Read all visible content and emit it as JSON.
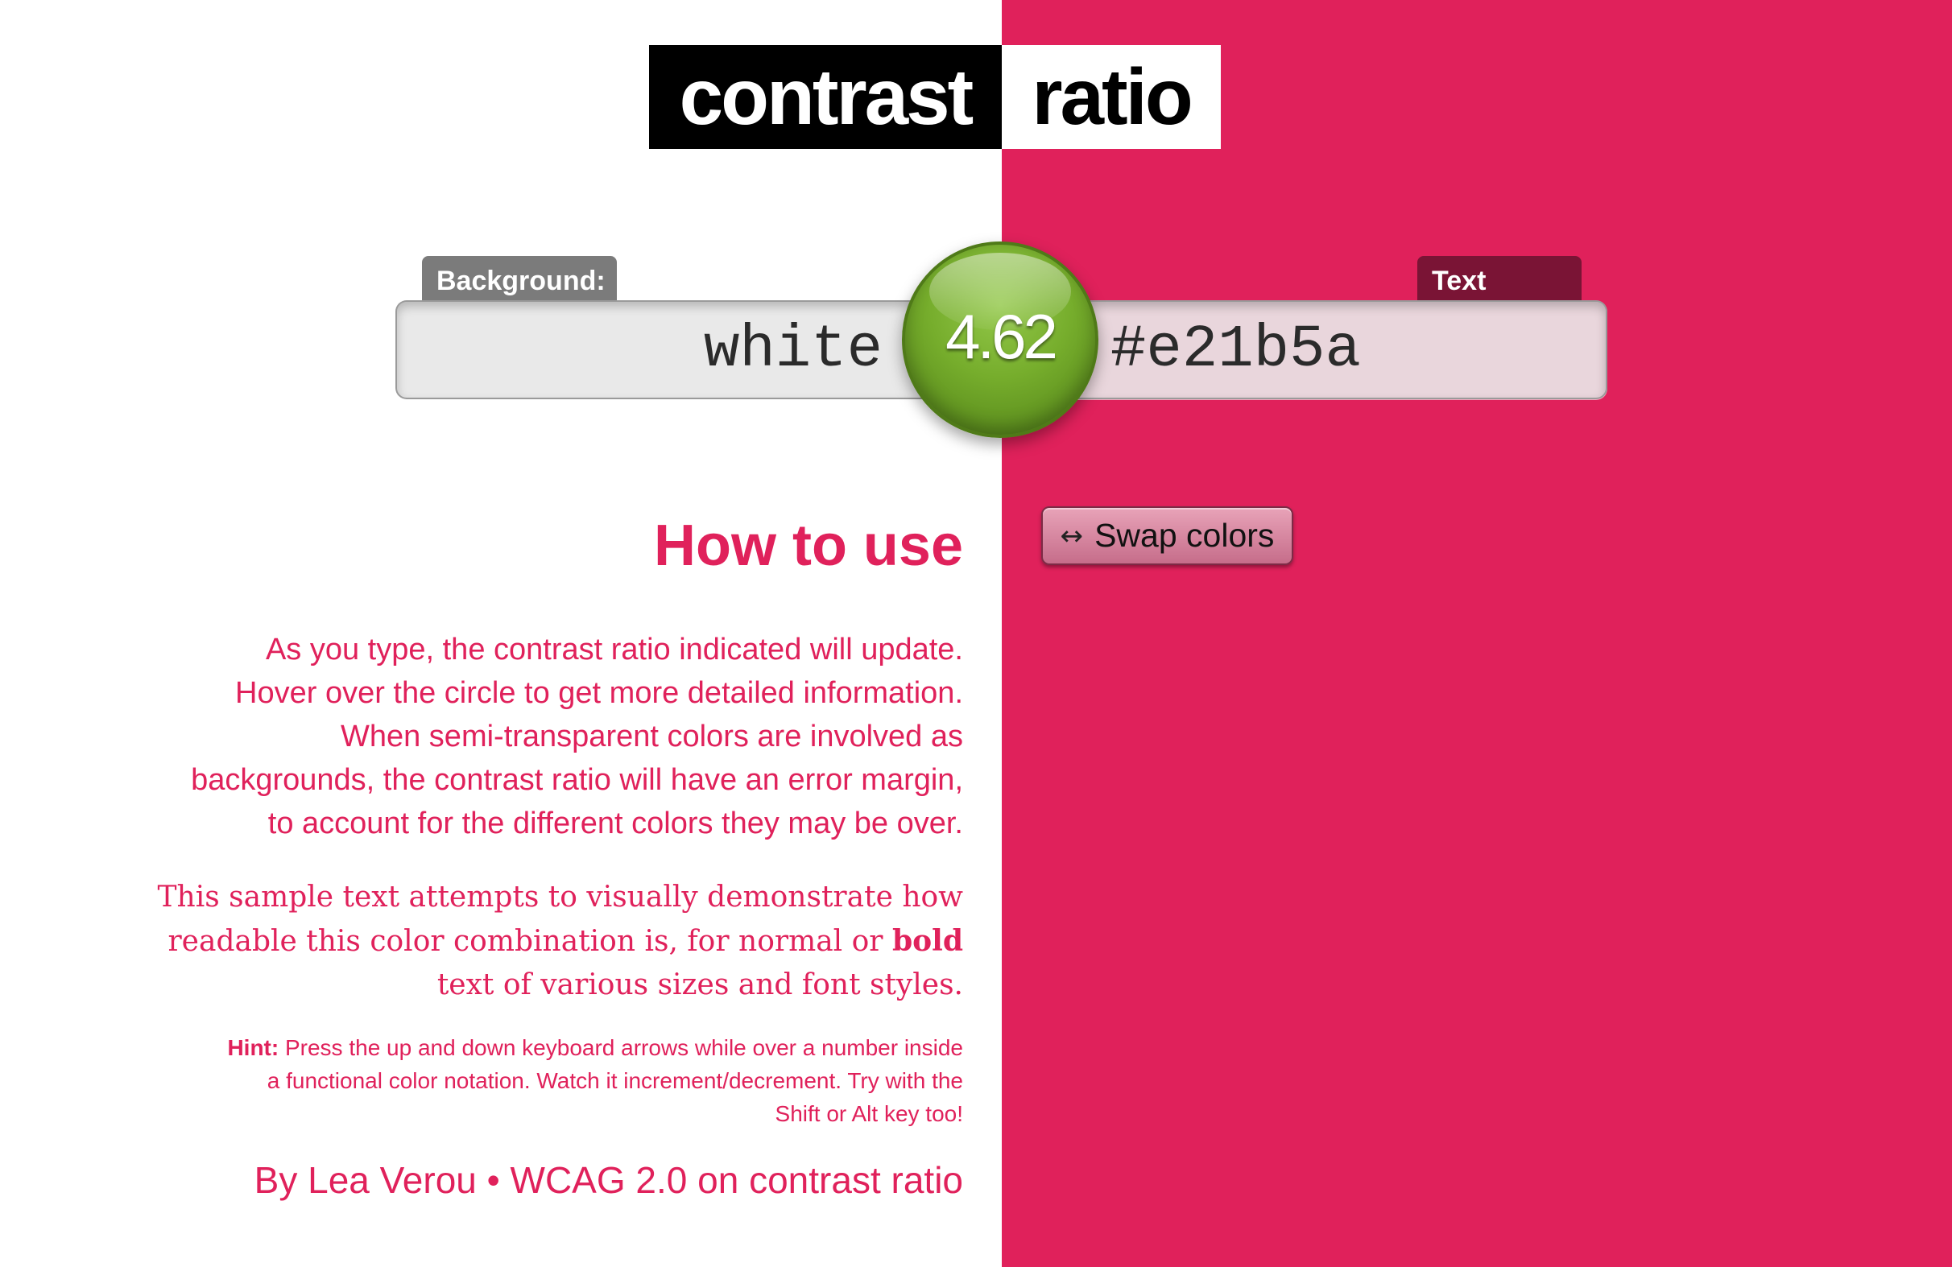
{
  "logo": {
    "word1": "contrast",
    "word2": "ratio"
  },
  "background_label": "Background:",
  "background_value": "white",
  "text_color_label": "Text color:",
  "text_color_value": "#e21b5a",
  "ratio": "4.62",
  "swap_button": {
    "icon": "↔",
    "label": "Swap colors"
  },
  "how_to": {
    "title": "How to use",
    "paragraph1": [
      "As you type, the contrast ratio indicated will update.",
      "Hover over the circle to get more detailed information.",
      "When semi-transparent colors are involved as",
      "backgrounds, the contrast ratio will have an error margin,",
      "to account for the different colors they may be over."
    ],
    "sample_text": [
      "This sample text attempts to visually demonstrate how",
      "readable this color combination is, for normal or",
      "bold",
      "text of various sizes and font styles."
    ],
    "hint_label": "Hint:",
    "hint_text": [
      "Press the up and down keyboard arrows while over a number inside",
      "a functional color notation. Watch it increment/decrement. Try with the",
      "Shift or Alt key too!"
    ]
  },
  "footer": {
    "author_link": "By Lea Verou",
    "separator": "•",
    "wcag_link": "WCAG 2.0 on contrast ratio"
  },
  "colors": {
    "accent": "#e0215b",
    "right_background": "#e0215b",
    "ratio_circle": "#76ad2c"
  }
}
